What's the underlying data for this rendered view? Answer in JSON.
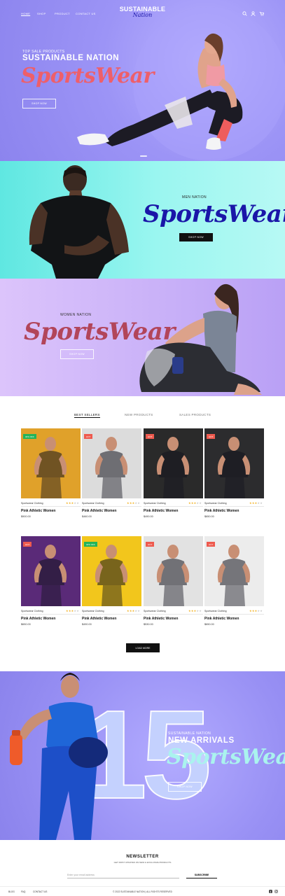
{
  "brand": {
    "name": "SUSTAINABLE",
    "sub": "Nation"
  },
  "nav": {
    "links": [
      "HOME",
      "SHOP",
      "PRODUCT",
      "CONTACT US"
    ],
    "icons": [
      "search-icon",
      "user-icon",
      "cart-icon"
    ]
  },
  "hero": {
    "kicker": "TOP SALE PRODUCTS",
    "title": "SUSTAINABLE NATION",
    "script": "SportsWear",
    "button": "SHOP NOW",
    "colors": {
      "script": "#ee5f6a",
      "background": "#9c94f6"
    }
  },
  "men_banner": {
    "kicker": "MEN NATION",
    "script": "SportsWear",
    "button": "SHOP NOW",
    "colors": {
      "script": "#1a16a8",
      "background": "#7aeee8"
    }
  },
  "women_banner": {
    "kicker": "WOMEN NATION",
    "script": "SportsWear",
    "button": "SHOP NOW",
    "colors": {
      "script": "#b2455a",
      "background": "#d4bcfa"
    }
  },
  "products": {
    "tabs": [
      "BEST SELLERS",
      "NEW PRODUCTS",
      "SALES PRODUCTS"
    ],
    "active_tab": "BEST SELLERS",
    "items": [
      {
        "badge": "30% OFF",
        "badge_color": "#23b45a",
        "brand": "Sportswear Clothing",
        "rating": 3,
        "name": "Pink Athletic Women",
        "price": "$900.00",
        "bg": "#e0a12a"
      },
      {
        "badge": "HOT",
        "badge_color": "#ee5a4e",
        "brand": "Sportswear Clothing",
        "rating": 3,
        "name": "Pink Athletic Women",
        "price": "$460.00",
        "bg": "#dcdcdc"
      },
      {
        "badge": "HOT",
        "badge_color": "#ee5a4e",
        "brand": "Sportswear Clothing",
        "rating": 3,
        "name": "Pink Athletic Women",
        "price": "$490.00",
        "bg": "#2a2a2a"
      },
      {
        "badge": "HOT",
        "badge_color": "#ee5a4e",
        "brand": "Sportswear Clothing",
        "rating": 3,
        "name": "Pink Athletic Women",
        "price": "$650.00",
        "bg": "#2c2c2e"
      },
      {
        "badge": "HOT",
        "badge_color": "#ee5a4e",
        "brand": "Sportswear Clothing",
        "rating": 3,
        "name": "Pink Athletic Women",
        "price": "$650.00",
        "bg": "#5a2a78"
      },
      {
        "badge": "30% OFF",
        "badge_color": "#23b45a",
        "brand": "Sportswear Clothing",
        "rating": 3,
        "name": "Pink Athletic Women",
        "price": "$490.00",
        "bg": "#f2c61c"
      },
      {
        "badge": "HOT",
        "badge_color": "#ee5a4e",
        "brand": "Sportswear Clothing",
        "rating": 3,
        "name": "Pink Athletic Women",
        "price": "$530.00",
        "bg": "#e2e2e2"
      },
      {
        "badge": "HOT",
        "badge_color": "#ee5a4e",
        "brand": "Sportswear Clothing",
        "rating": 3,
        "name": "Pink Athletic Women",
        "price": "$650.00",
        "bg": "#ececec"
      }
    ],
    "load_more": "LOAD MORE"
  },
  "arrivals": {
    "number": "15",
    "kicker": "SUSTAINABLE NATION",
    "title": "NEW ARRIVALS",
    "script": "SportsWear",
    "button": "SHOP NOW",
    "colors": {
      "script": "#aaf3ee",
      "number": "#c6d4ff"
    }
  },
  "newsletter": {
    "title": "NEWSLETTER",
    "subtitle": "GET FIRST UPDATES ON NEW & EXCLUSIVE PRODUCTS",
    "placeholder": "Enter your email address",
    "button": "SUBSCRIBE"
  },
  "footer": {
    "links": [
      "BLOG",
      "FAQ",
      "CONTACT US"
    ],
    "copyright": "© 2022 SUSTAINABLE NATION | ALL RIGHTS RESERVED",
    "social": [
      "facebook-icon",
      "instagram-icon"
    ]
  }
}
